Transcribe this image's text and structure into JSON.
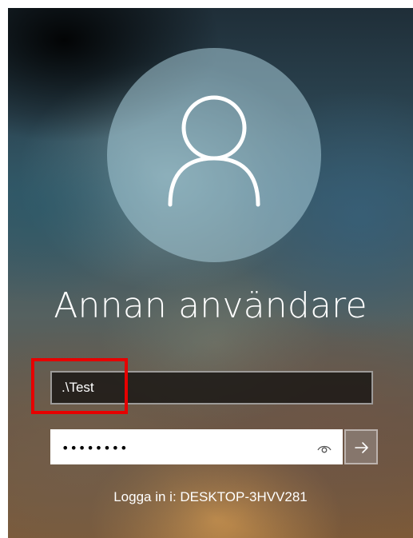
{
  "user": {
    "display_name": "Annan användare"
  },
  "username_field": {
    "value": ".\\Test"
  },
  "password_field": {
    "masked_value": "••••••••",
    "reveal_icon": "eye-icon"
  },
  "submit": {
    "icon": "arrow-right-icon"
  },
  "sign_in_to": {
    "label": "Logga in i: DESKTOP-3HVV281"
  },
  "annotation": {
    "highlight_color": "#e60000"
  },
  "colors": {
    "text": "#ffffff",
    "password_bg": "#ffffff"
  }
}
